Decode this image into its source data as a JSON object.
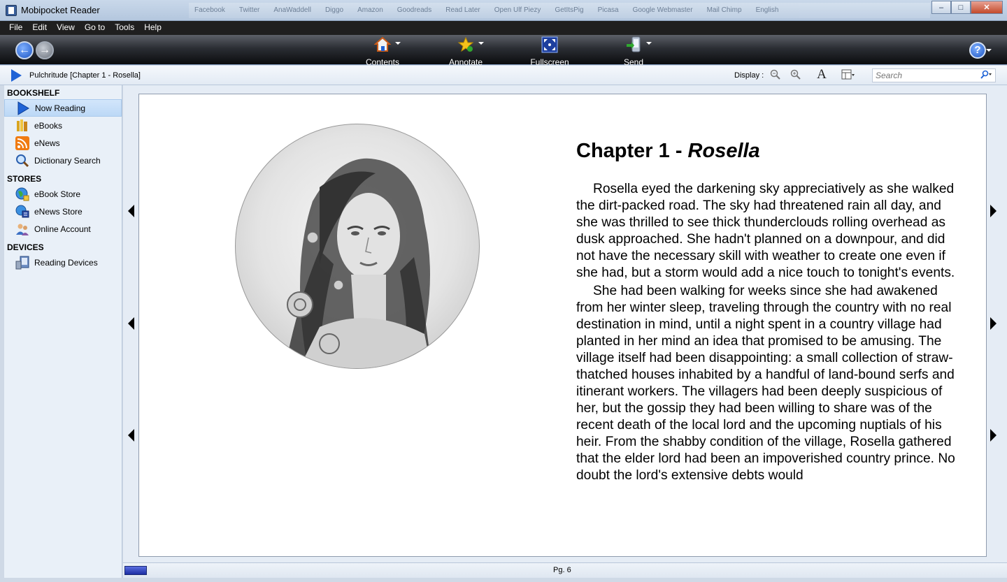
{
  "window": {
    "title": "Mobipocket Reader",
    "bookmarks": [
      "Facebook",
      "Twitter",
      "AnaWaddell",
      "Diggo",
      "Amazon",
      "Goodreads",
      "Read Later",
      "Open Ulf Piezy",
      "GetItsPig",
      "Picasa",
      "Google Webmaster",
      "Mail Chimp",
      "English"
    ],
    "controls": {
      "minimize": "–",
      "maximize": "□",
      "close": "✕"
    }
  },
  "menu": [
    "File",
    "Edit",
    "View",
    "Go to",
    "Tools",
    "Help"
  ],
  "toolbar": {
    "back_icon": "←",
    "forward_icon": "→",
    "items": [
      {
        "label": "Contents",
        "icon": "house-icon"
      },
      {
        "label": "Annotate",
        "icon": "star-icon"
      },
      {
        "label": "Fullscreen",
        "icon": "fullscreen-icon"
      },
      {
        "label": "Send",
        "icon": "send-device-icon"
      }
    ],
    "help_label": "?"
  },
  "crumb": {
    "text": "Pulchritude [Chapter 1 - Rosella]",
    "display_label": "Display :",
    "font_label": "A",
    "search_placeholder": "Search"
  },
  "sidebar": {
    "bookshelf_heading": "BOOKSHELF",
    "bookshelf": [
      "Now Reading",
      "eBooks",
      "eNews",
      "Dictionary Search"
    ],
    "stores_heading": "STORES",
    "stores": [
      "eBook Store",
      "eNews Store",
      "Online Account"
    ],
    "devices_heading": "DEVICES",
    "devices": [
      "Reading Devices"
    ]
  },
  "book": {
    "chapter_prefix": "Chapter 1 - ",
    "chapter_name": "Rosella",
    "paragraphs": [
      "Rosella eyed the darkening sky appreciatively as she walked the dirt-packed road. The sky had threatened rain all day, and she was thrilled to see thick thunderclouds rolling overhead as dusk approached. She hadn't planned on a downpour, and did not have the necessary skill with weather to create one even if she had, but a storm would add a nice touch to tonight's events.",
      "She had been walking for weeks since she had awakened from her winter sleep, traveling through the country with no real destination in mind, until a night spent in a country village had planted in her mind an idea that promised to be amusing. The village itself had been disappointing: a small collection of straw-thatched houses inhabited by a handful of land-bound serfs and itinerant workers. The villagers had been deeply suspicious of her, but the gossip they had been willing to share was of the recent death of the local lord and the upcoming nuptials of his heir. From the shabby condition of the village, Rosella gathered that the elder lord had been an impoverished country prince. No doubt the lord's extensive debts would"
    ]
  },
  "status": {
    "page": "Pg. 6"
  },
  "colors": {
    "accent": "#1f63d6",
    "toolbar_dark": "#0b0c0e",
    "sidebar_bg": "#e9f0f8"
  }
}
